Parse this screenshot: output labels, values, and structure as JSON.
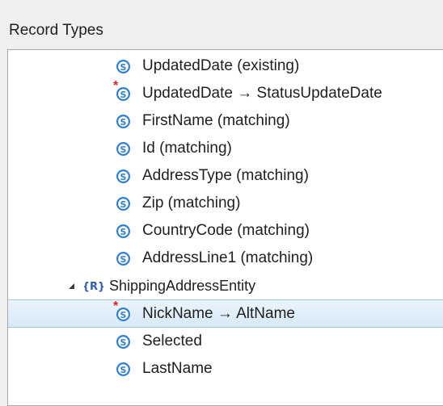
{
  "panel": {
    "title": "Record Types"
  },
  "tree": {
    "items": [
      {
        "label": "UpdatedDate (existing)",
        "icon": "s-icon",
        "changed": false
      },
      {
        "label": "UpdatedDate → StatusUpdateDate",
        "icon": "s-icon",
        "changed": true
      },
      {
        "label": "FirstName (matching)",
        "icon": "s-icon",
        "changed": false
      },
      {
        "label": "Id (matching)",
        "icon": "s-icon",
        "changed": false
      },
      {
        "label": "AddressType (matching)",
        "icon": "s-icon",
        "changed": false
      },
      {
        "label": "Zip (matching)",
        "icon": "s-icon",
        "changed": false
      },
      {
        "label": "CountryCode (matching)",
        "icon": "s-icon",
        "changed": false
      },
      {
        "label": "AddressLine1 (matching)",
        "icon": "s-icon",
        "changed": false
      },
      {
        "label": "ShippingAddressEntity",
        "icon": "r-icon",
        "icon_text": "{R}",
        "expanded": true
      },
      {
        "label": "NickName → AltName",
        "icon": "s-icon",
        "changed": true,
        "selected": true
      },
      {
        "label": "Selected",
        "icon": "s-icon",
        "changed": false
      },
      {
        "label": "LastName",
        "icon": "s-icon",
        "changed": false
      }
    ]
  },
  "colors": {
    "s_icon": "#2f7fd1",
    "r_icon": "#2f5fb0",
    "changed_mark": "#e0202a",
    "selection": "#d7e9f8"
  }
}
